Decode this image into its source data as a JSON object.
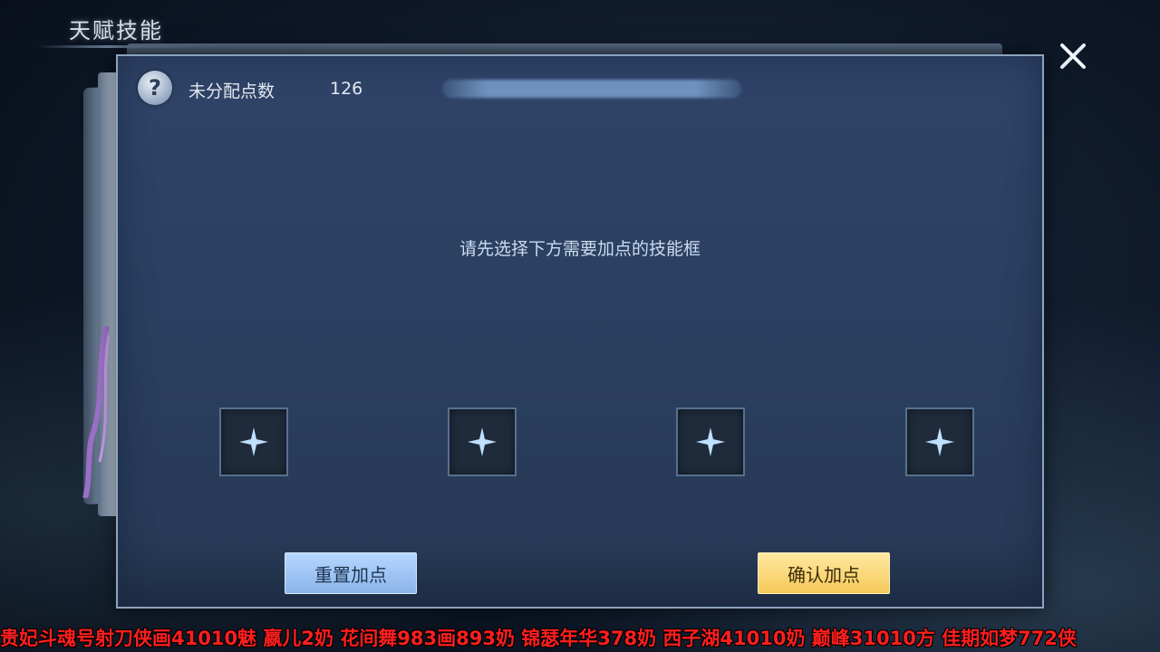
{
  "window": {
    "title": "天赋技能"
  },
  "panel": {
    "points_label": "未分配点数",
    "points_value": "126",
    "hint": "请先选择下方需要加点的技能框",
    "slots": [
      {
        "icon": "plus-icon"
      },
      {
        "icon": "plus-icon"
      },
      {
        "icon": "plus-icon"
      },
      {
        "icon": "plus-icon"
      }
    ],
    "reset_button": "重置加点",
    "confirm_button": "确认加点"
  },
  "overlay": {
    "marquee": "贵妃斗魂号射刀侠画41010魅  嬴儿2奶  花间舞983画893奶  锦瑟年华378奶  西子湖41010奶  巅峰31010方  佳期如梦772侠"
  },
  "colors": {
    "panel": "#2d4264",
    "confirm": "#f5c95a",
    "reset": "#8ab5ea",
    "marquee": "#ff1e1e"
  }
}
